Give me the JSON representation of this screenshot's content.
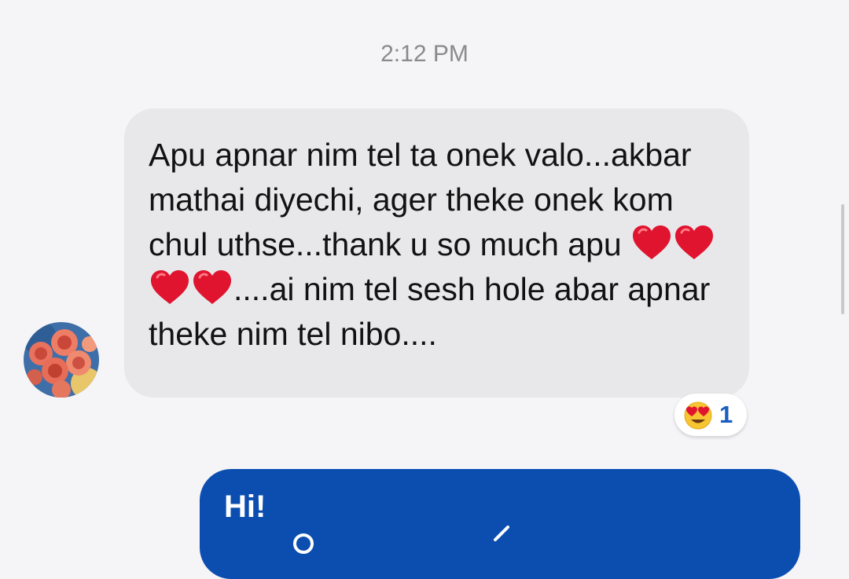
{
  "conversation": {
    "timestamp": "2:12 PM"
  },
  "incoming_message": {
    "text_before_hearts": "Apu apnar nim tel ta onek valo...akbar mathai diyechi, ager theke onek kom chul uthse...thank u so much apu ",
    "hearts": 4,
    "heart_emoji": "red-heart",
    "text_after_hearts": "....ai nim tel sesh hole abar apnar theke nim tel nibo....",
    "sender_avatar": "rose-bouquet-photo",
    "reaction": {
      "emoji": "smiling-face-with-heart-eyes",
      "count": "1"
    }
  },
  "outgoing_message": {
    "text": "Hi!"
  },
  "colors": {
    "background": "#f5f5f7",
    "incoming_bubble": "#e8e8ea",
    "outgoing_bubble": "#0b4eb0",
    "reaction_count": "#1a5dbf",
    "heart": "#e0142f"
  }
}
